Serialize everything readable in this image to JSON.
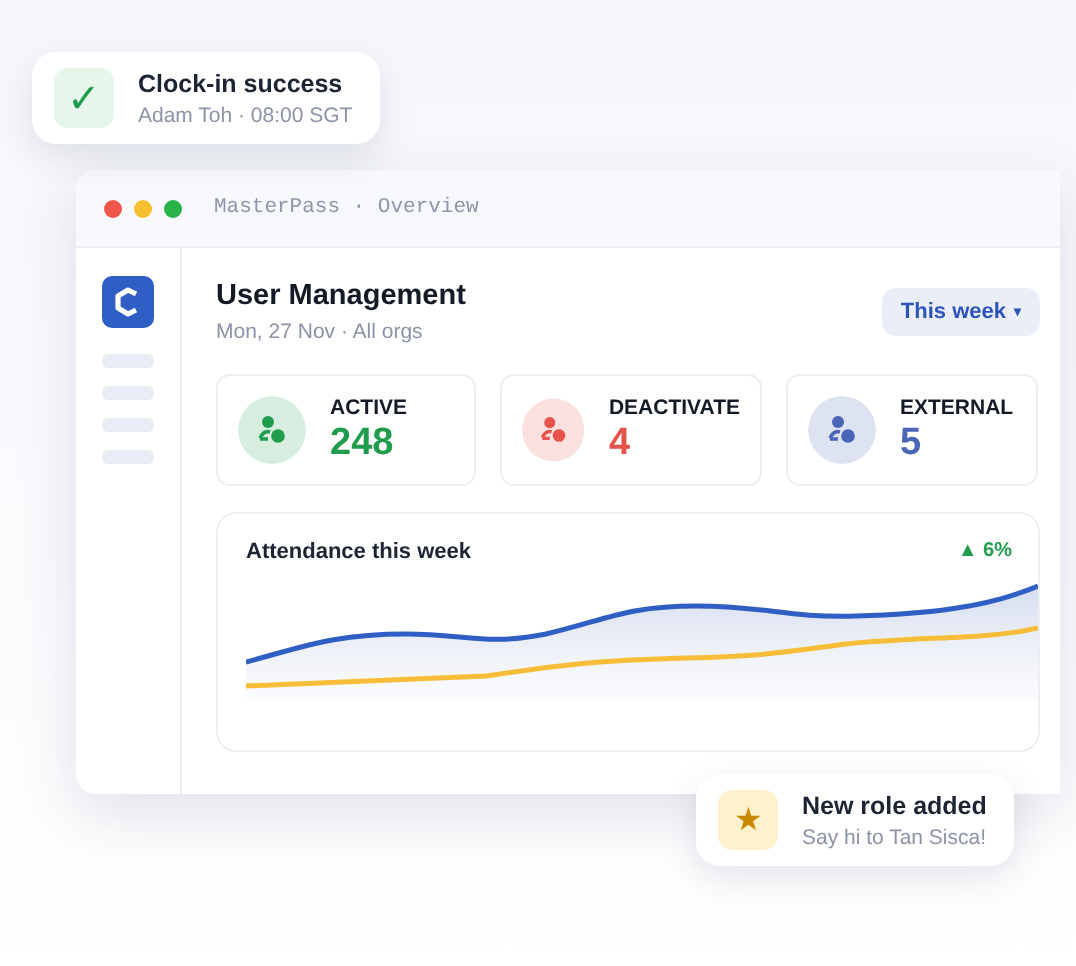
{
  "window": {
    "title": "MasterPass · Overview"
  },
  "header": {
    "title": "User Management",
    "subtitle": "Mon, 27 Nov · All orgs",
    "period_button": "This week",
    "period_caret": "▾"
  },
  "stats": [
    {
      "label": "ACTIVE",
      "value": "248",
      "color": "#1f9d4d"
    },
    {
      "label": "DEACTIVATE",
      "value": "4",
      "color": "#e5534b"
    },
    {
      "label": "EXTERNAL",
      "value": "5",
      "color": "#4a64b8"
    }
  ],
  "chart": {
    "title": "Attendance this week",
    "trend": "▲ 6%"
  },
  "toasts": [
    {
      "kind": "success",
      "title": "Clock-in success",
      "subtitle": "Adam Toh · 08:00 SGT",
      "icon": "✓"
    },
    {
      "kind": "role",
      "title": "New role added",
      "subtitle": "Say hi to Tan Sisca!",
      "icon": "★"
    }
  ]
}
